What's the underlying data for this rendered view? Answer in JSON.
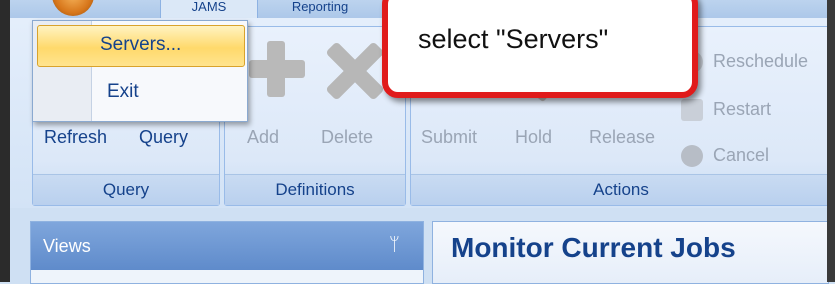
{
  "tabs": [
    {
      "label": "JAMS"
    },
    {
      "label": "Reporting"
    }
  ],
  "app_menu": {
    "items": [
      {
        "label": "Servers..."
      },
      {
        "label": "Exit"
      }
    ]
  },
  "ribbon": {
    "query_group": {
      "label": "Query",
      "buttons": [
        {
          "label": "Refresh"
        },
        {
          "label": "Query"
        }
      ]
    },
    "definitions_group": {
      "label": "Definitions",
      "buttons": [
        {
          "label": "Add"
        },
        {
          "label": "Delete"
        }
      ]
    },
    "actions_group": {
      "label": "Actions",
      "buttons": [
        {
          "label": "Submit"
        },
        {
          "label": "Hold"
        },
        {
          "label": "Release"
        }
      ],
      "side_buttons": [
        {
          "label": "Reschedule"
        },
        {
          "label": "Restart"
        },
        {
          "label": "Cancel"
        }
      ]
    }
  },
  "callout": {
    "text": "select \"Servers\""
  },
  "panes": {
    "views_title": "Views",
    "views_pin_glyph": "ᛘ",
    "monitor_title": "Monitor Current Jobs"
  },
  "colors": {
    "ribbon_text": "#15428b",
    "disabled_text": "#9aa5b5",
    "callout_border": "#e01b1b",
    "menu_highlight": "#ffd96b"
  }
}
